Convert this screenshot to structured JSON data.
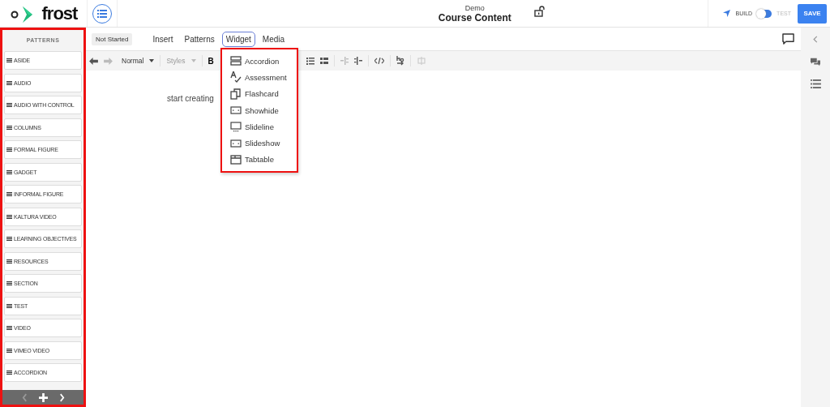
{
  "header": {
    "logo": "frost",
    "subtitle": "Demo",
    "title": "Course Content",
    "build_label": "BUILD",
    "test_label": "TEST",
    "toggle": {
      "on": false
    },
    "save": "SAVE"
  },
  "sidebar": {
    "title": "PATTERNS",
    "items": [
      {
        "label": "ASIDE"
      },
      {
        "label": "AUDIO"
      },
      {
        "label": "AUDIO WITH CONTROL"
      },
      {
        "label": "COLUMNS"
      },
      {
        "label": "FORMAL FIGURE"
      },
      {
        "label": "GADGET"
      },
      {
        "label": "INFORMAL FIGURE"
      },
      {
        "label": "KALTURA VIDEO"
      },
      {
        "label": "LEARNING OBJECTIVES"
      },
      {
        "label": "RESOURCES"
      },
      {
        "label": "SECTION"
      },
      {
        "label": "TEST"
      },
      {
        "label": "VIDEO"
      },
      {
        "label": "VIMEO VIDEO"
      },
      {
        "label": "ACCORDION"
      }
    ]
  },
  "status": "Not Started",
  "tabs": [
    {
      "label": "Insert",
      "selected": false
    },
    {
      "label": "Patterns",
      "selected": false
    },
    {
      "label": "Widget",
      "selected": true
    },
    {
      "label": "Media",
      "selected": false
    }
  ],
  "toolbar": {
    "block_style": "Normal",
    "styles": "Styles",
    "bold": "B"
  },
  "widget_menu": [
    {
      "label": "Accordion",
      "kind": "accordion"
    },
    {
      "label": "Assessment",
      "kind": "assessment"
    },
    {
      "label": "Flashcard",
      "kind": "flashcard"
    },
    {
      "label": "Showhide",
      "kind": "panel"
    },
    {
      "label": "Slideline",
      "kind": "monitor"
    },
    {
      "label": "Slideshow",
      "kind": "panel"
    },
    {
      "label": "Tabtable",
      "kind": "tab"
    }
  ],
  "editor": {
    "placeholder": "start creating"
  }
}
